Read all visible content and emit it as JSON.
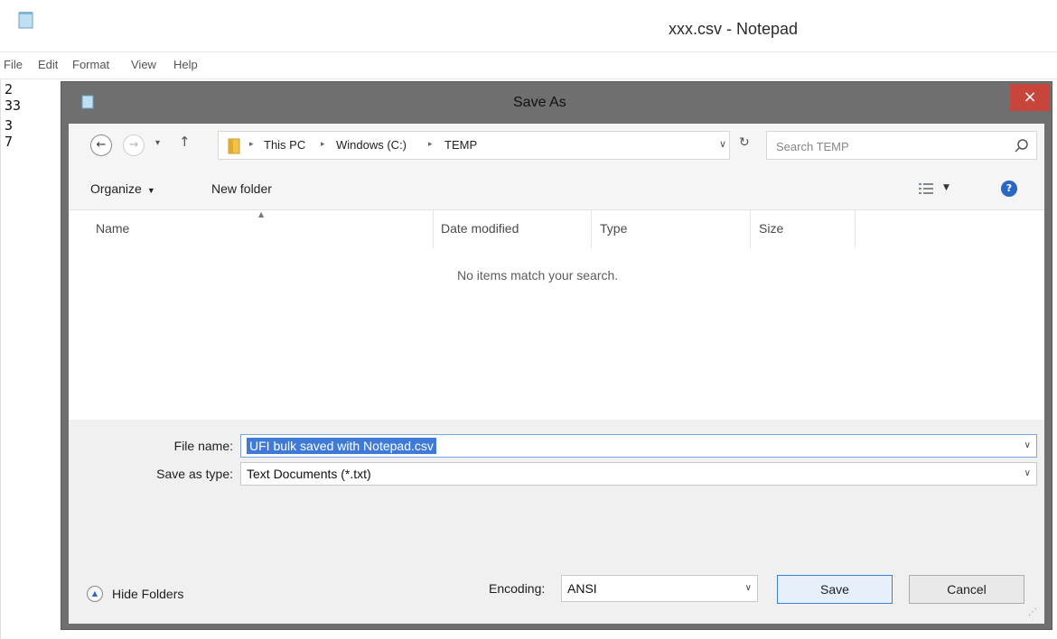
{
  "notepad": {
    "title": "xxx.csv - Notepad",
    "menu": [
      "File",
      "Edit",
      "Format",
      "View",
      "Help"
    ],
    "lines": [
      "2",
      "33",
      "3",
      "7"
    ]
  },
  "dialog": {
    "title": "Save As",
    "close_glyph": "×",
    "nav": {
      "back_glyph": "←",
      "forward_glyph": "→",
      "recent_glyph": "▾",
      "up_glyph": "↑"
    },
    "breadcrumb": [
      "This PC",
      "Windows (C:)",
      "TEMP"
    ],
    "crumb_separator": "▸",
    "refresh_glyph": "↻",
    "search": {
      "placeholder": "Search TEMP"
    },
    "toolbar": {
      "organize": "Organize",
      "new_folder": "New folder",
      "help_glyph": "?"
    },
    "columns": [
      "Name",
      "Date modified",
      "Type",
      "Size"
    ],
    "empty_message": "No items match your search.",
    "file_name_label": "File name:",
    "file_name_value": "UFI bulk saved with Notepad.csv",
    "save_type_label": "Save as type:",
    "save_type_value": "Text Documents (*.txt)",
    "hide_folders": "Hide Folders",
    "encoding_label": "Encoding:",
    "encoding_value": "ANSI",
    "save_button": "Save",
    "cancel_button": "Cancel"
  },
  "colors": {
    "close_red": "#c7453a",
    "selection_blue": "#3f7bd6",
    "dialog_chrome": "#6f6f6f",
    "help_blue": "#2a66c4"
  }
}
